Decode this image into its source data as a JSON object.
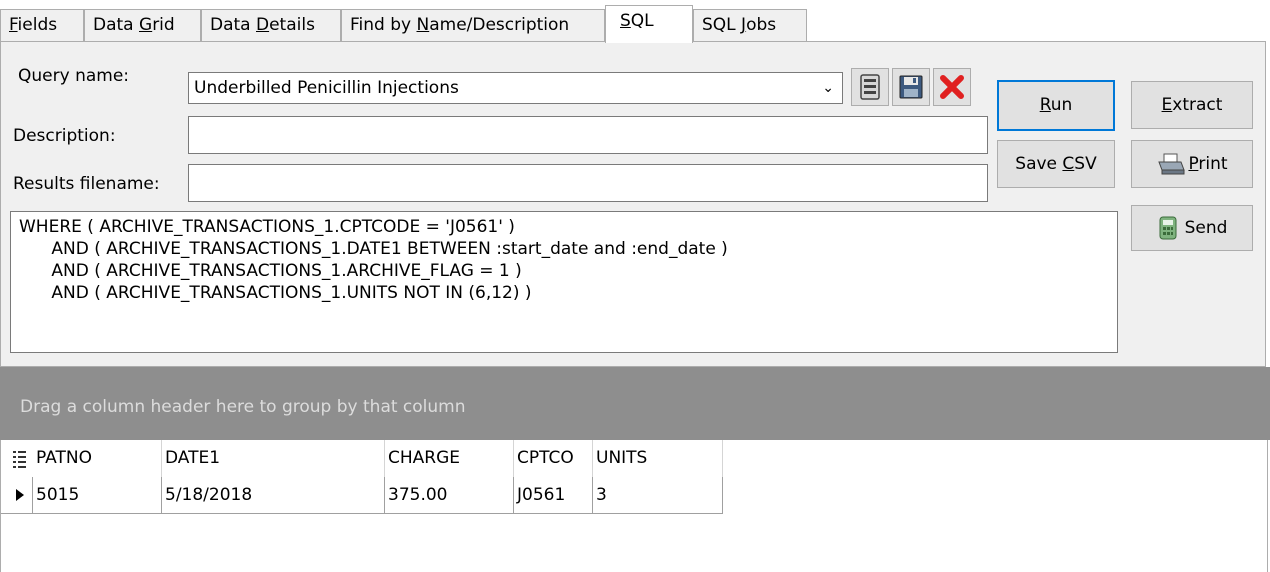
{
  "tabs": [
    {
      "pre": "",
      "key": "F",
      "post": "ields",
      "active": false
    },
    {
      "pre": "Data ",
      "key": "G",
      "post": "rid",
      "active": false
    },
    {
      "pre": "Data ",
      "key": "D",
      "post": "etails",
      "active": false
    },
    {
      "pre": "Find by ",
      "key": "N",
      "post": "ame/Description",
      "active": false
    },
    {
      "pre": "",
      "key": "S",
      "post": "QL",
      "active": true
    },
    {
      "pre": "SQL ",
      "key": "J",
      "post": "obs",
      "active": false
    }
  ],
  "form": {
    "query_name_label": "Query name:",
    "query_name_value": "Underbilled Penicillin Injections",
    "description_label": "Description:",
    "description_value": "",
    "results_filename_label": "Results filename:",
    "results_filename_value": ""
  },
  "icons": {
    "save": "save-icon",
    "save_as": "save-as-icon",
    "delete": "delete-icon",
    "print": "printer-icon",
    "send": "calculator-icon"
  },
  "buttons": {
    "run": {
      "pre": "",
      "key": "R",
      "post": "un"
    },
    "extract": {
      "pre": "",
      "key": "E",
      "post": "xtract"
    },
    "save_csv": {
      "pre": "Save ",
      "key": "C",
      "post": "SV"
    },
    "print": {
      "pre": "",
      "key": "P",
      "post": "rint"
    },
    "send": {
      "label": "Send"
    }
  },
  "sql_text": "WHERE ( ARCHIVE_TRANSACTIONS_1.CPTCODE = 'J0561' )\n      AND ( ARCHIVE_TRANSACTIONS_1.DATE1 BETWEEN :start_date and :end_date )\n      AND ( ARCHIVE_TRANSACTIONS_1.ARCHIVE_FLAG = 1 )\n      AND ( ARCHIVE_TRANSACTIONS_1.UNITS NOT IN (6,12) )",
  "group_panel_hint": "Drag a column header here to group by that column",
  "grid": {
    "columns": [
      "PATNO",
      "DATE1",
      "CHARGE",
      "CPTCO",
      "UNITS"
    ],
    "rows": [
      [
        "5015",
        "5/18/2018",
        "375.00",
        "J0561",
        "3"
      ]
    ]
  },
  "colors": {
    "panel_bg": "#f0f0f0",
    "group_bar_bg": "#8e8e8e",
    "delete_red": "#e02020",
    "focus_blue": "#0078d7"
  }
}
